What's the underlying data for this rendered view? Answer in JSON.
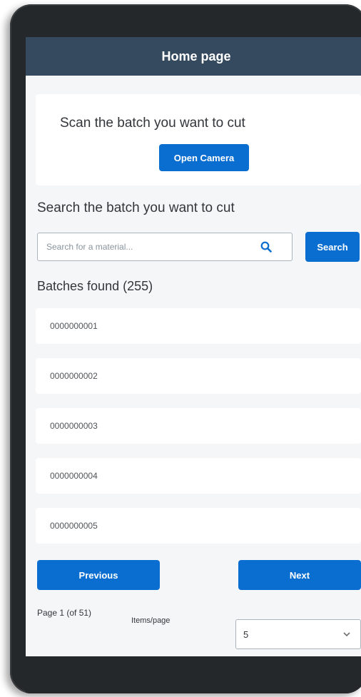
{
  "header": {
    "title": "Home page"
  },
  "scan_card": {
    "title": "Scan the batch you want to cut",
    "open_camera_label": "Open Camera"
  },
  "search": {
    "title": "Search the batch you want to cut",
    "placeholder": "Search for a material...",
    "value": "",
    "button_label": "Search",
    "icon": "search-icon"
  },
  "batches": {
    "title": "Batches found (255)",
    "items": [
      "0000000001",
      "0000000002",
      "0000000003",
      "0000000004",
      "0000000005"
    ]
  },
  "pagination": {
    "previous_label": "Previous",
    "next_label": "Next",
    "page_info": "Page 1 (of 51)",
    "items_per_page_label": "Items/page",
    "items_per_page_value": "5",
    "select_icon": "chevron-down-icon"
  },
  "colors": {
    "header_bg": "#354a5f",
    "primary": "#0a6ed1",
    "background": "#f5f6f7",
    "device_frame": "#25282b"
  }
}
